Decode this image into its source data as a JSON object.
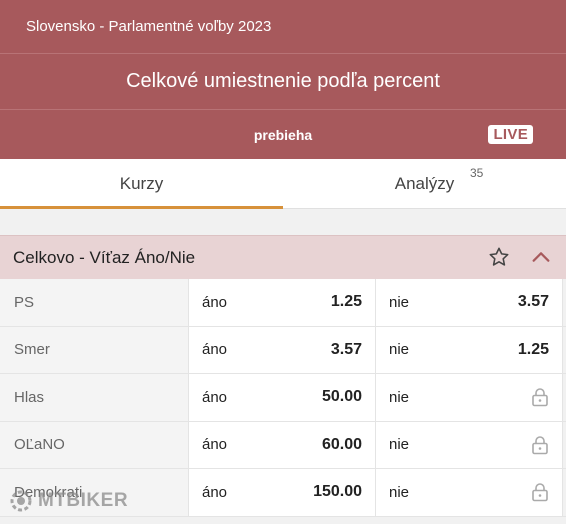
{
  "header": {
    "competition": "Slovensko - Parlamentné voľby 2023",
    "title": "Celkové umiestnenie podľa percent",
    "status": "prebieha",
    "live_badge": "LIVE"
  },
  "tabs": [
    {
      "label": "Kurzy",
      "active": true
    },
    {
      "label": "Analýzy",
      "count": "35",
      "active": false
    }
  ],
  "market": {
    "title": "Celkovo - Víťaz Áno/Nie",
    "icons": [
      "star-icon",
      "chevron-up-icon"
    ]
  },
  "rows": [
    {
      "name": "PS",
      "yes_label": "áno",
      "yes_odd": "1.25",
      "no_label": "nie",
      "no_odd": "3.57",
      "no_locked": false
    },
    {
      "name": "Smer",
      "yes_label": "áno",
      "yes_odd": "3.57",
      "no_label": "nie",
      "no_odd": "1.25",
      "no_locked": false
    },
    {
      "name": "Hlas",
      "yes_label": "áno",
      "yes_odd": "50.00",
      "no_label": "nie",
      "no_odd": "",
      "no_locked": true
    },
    {
      "name": "OĽaNO",
      "yes_label": "áno",
      "yes_odd": "60.00",
      "no_label": "nie",
      "no_odd": "",
      "no_locked": true
    },
    {
      "name": "Demokrati",
      "yes_label": "áno",
      "yes_odd": "150.00",
      "no_label": "nie",
      "no_odd": "",
      "no_locked": true
    }
  ],
  "watermark": "MTBIKER",
  "colors": {
    "header_bg": "#a7595c",
    "section_bg": "#e8d3d4",
    "tab_accent": "#d7913a"
  }
}
